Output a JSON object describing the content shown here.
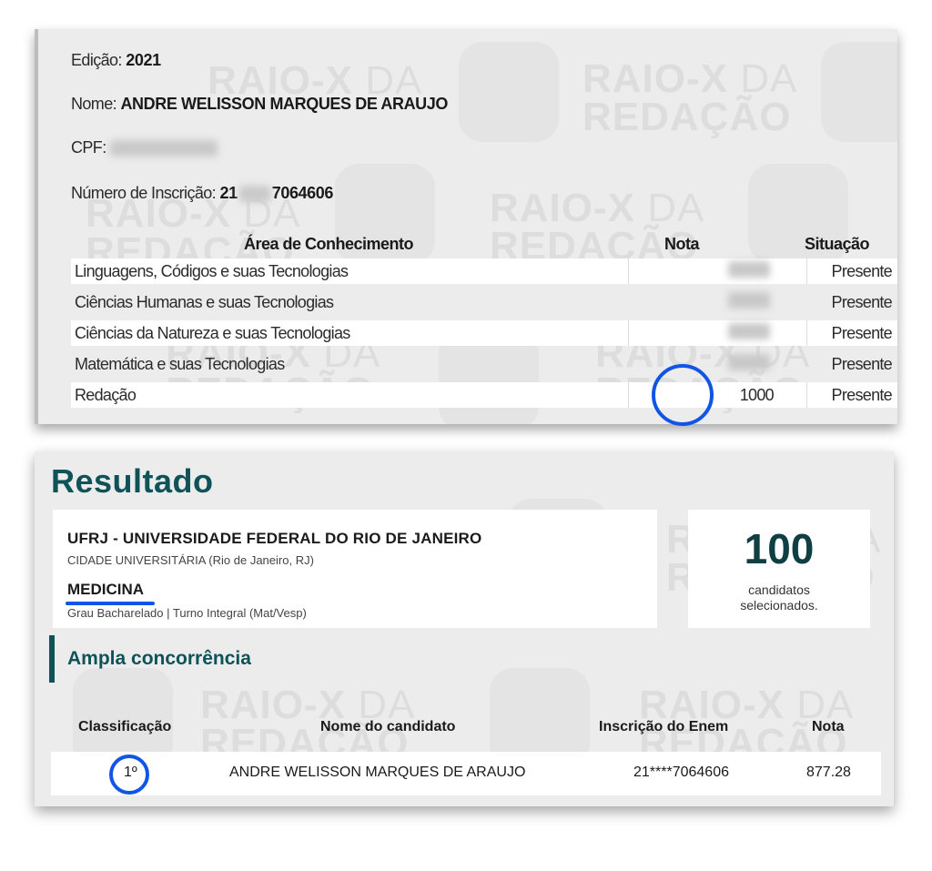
{
  "candidate": {
    "edition_label": "Edição:",
    "edition_value": "2021",
    "name_label": "Nome:",
    "name_value": "ANDRE WELISSON MARQUES DE ARAUJO",
    "cpf_label": "CPF:",
    "registration_label": "Número de Inscrição:",
    "registration_prefix": "21",
    "registration_suffix": "7064606"
  },
  "scores": {
    "headers": {
      "area": "Área de Conhecimento",
      "nota": "Nota",
      "situacao": "Situação"
    },
    "rows": [
      {
        "area": "Linguagens, Códigos e suas Tecnologias",
        "nota": "",
        "situacao": "Presente"
      },
      {
        "area": "Ciências Humanas e suas Tecnologias",
        "nota": "",
        "situacao": "Presente"
      },
      {
        "area": "Ciências da Natureza e suas Tecnologias",
        "nota": "",
        "situacao": "Presente"
      },
      {
        "area": "Matemática e suas Tecnologias",
        "nota": "",
        "situacao": "Presente"
      },
      {
        "area": "Redação",
        "nota": "1000",
        "situacao": "Presente"
      }
    ]
  },
  "result": {
    "title": "Resultado",
    "university": "UFRJ - UNIVERSIDADE FEDERAL DO RIO DE JANEIRO",
    "campus": "CIDADE UNIVERSITÁRIA (Rio de Janeiro, RJ)",
    "course": "MEDICINA",
    "course_details": "Grau Bacharelado | Turno Integral (Mat/Vesp)",
    "selected_count": "100",
    "selected_label_1": "candidatos",
    "selected_label_2": "selecionados.",
    "category": "Ampla concorrência",
    "table_headers": {
      "classificacao": "Classificação",
      "nome": "Nome do candidato",
      "inscricao": "Inscrição do Enem",
      "nota": "Nota"
    },
    "table_row": {
      "classificacao": "1º",
      "nome": "ANDRE WELISSON MARQUES DE ARAUJO",
      "inscricao": "21****7064606",
      "nota": "877.28"
    }
  },
  "watermark": {
    "line1": "RAIO-X",
    "da": "DA",
    "line2": "REDAÇÃO"
  },
  "colors": {
    "accent_teal": "#0f5257",
    "highlight_blue": "#1155e6"
  }
}
